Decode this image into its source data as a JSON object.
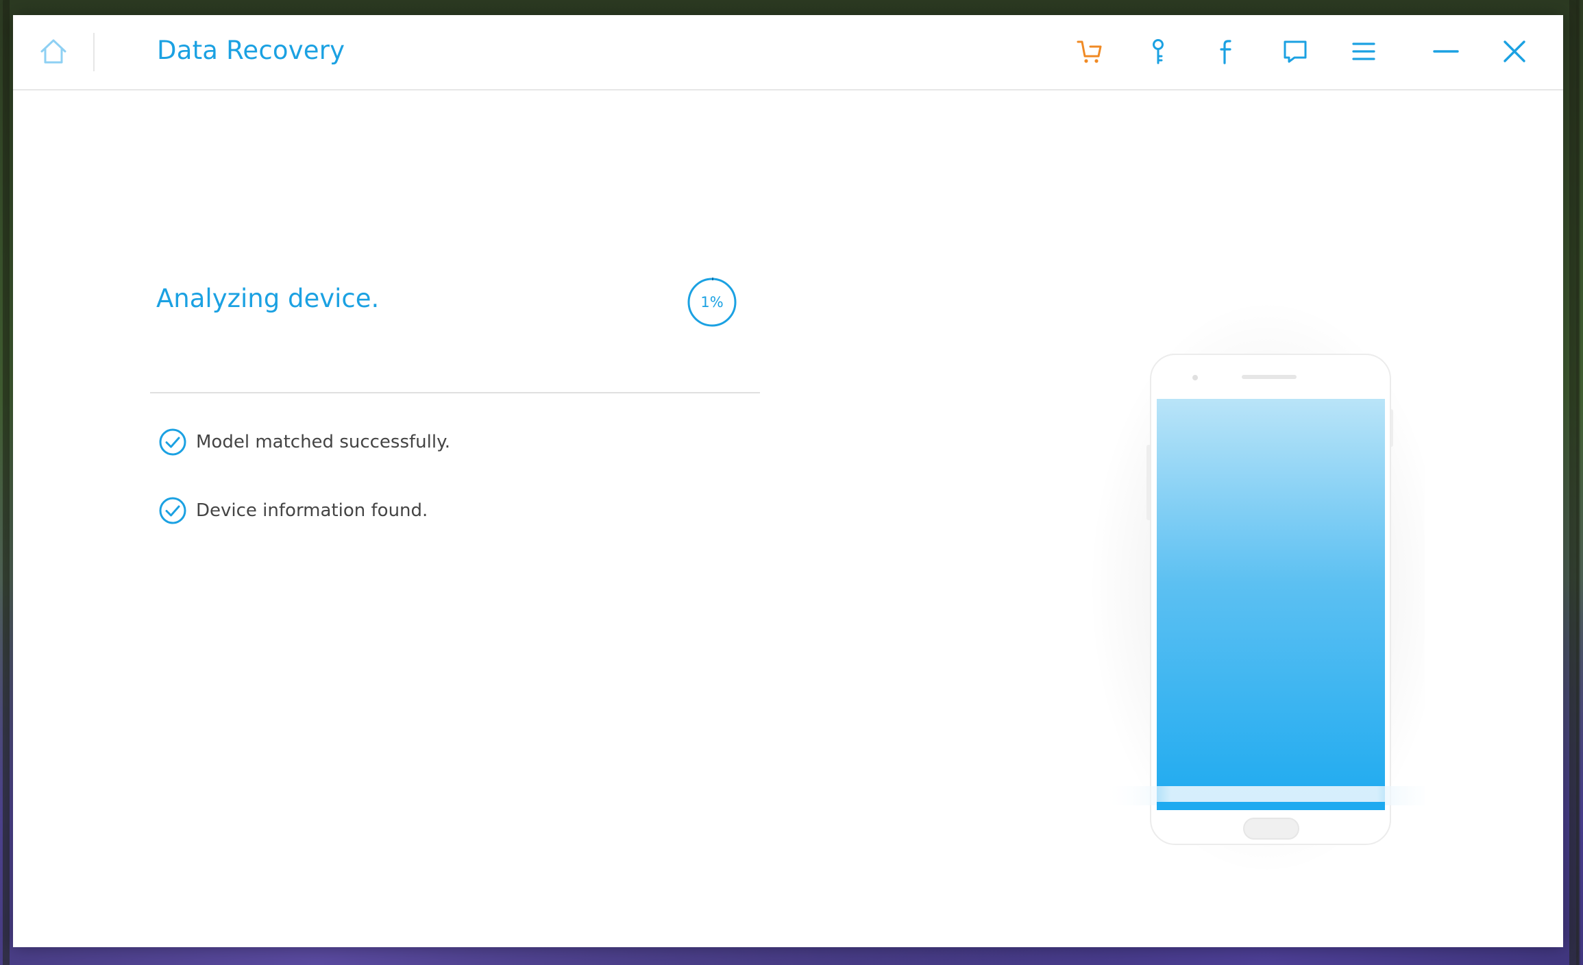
{
  "window": {
    "title": "Data Recovery"
  },
  "toolbar": {
    "icons": [
      "home-icon",
      "cart-icon",
      "key-icon",
      "facebook-icon",
      "feedback-icon",
      "menu-icon",
      "minimize-icon",
      "close-icon"
    ],
    "accent_color": "#1ba1e2",
    "cart_color": "#f08a24"
  },
  "main": {
    "status_title": "Analyzing device.",
    "progress_text": "1%",
    "progress_value": 0.01,
    "steps": [
      {
        "label": "Model matched successfully.",
        "icon": "check-circle-icon"
      },
      {
        "label": "Device information found.",
        "icon": "check-circle-icon"
      }
    ]
  },
  "illustration": {
    "icon": "phone-illustration",
    "screen_color": "#1eaaf0"
  }
}
